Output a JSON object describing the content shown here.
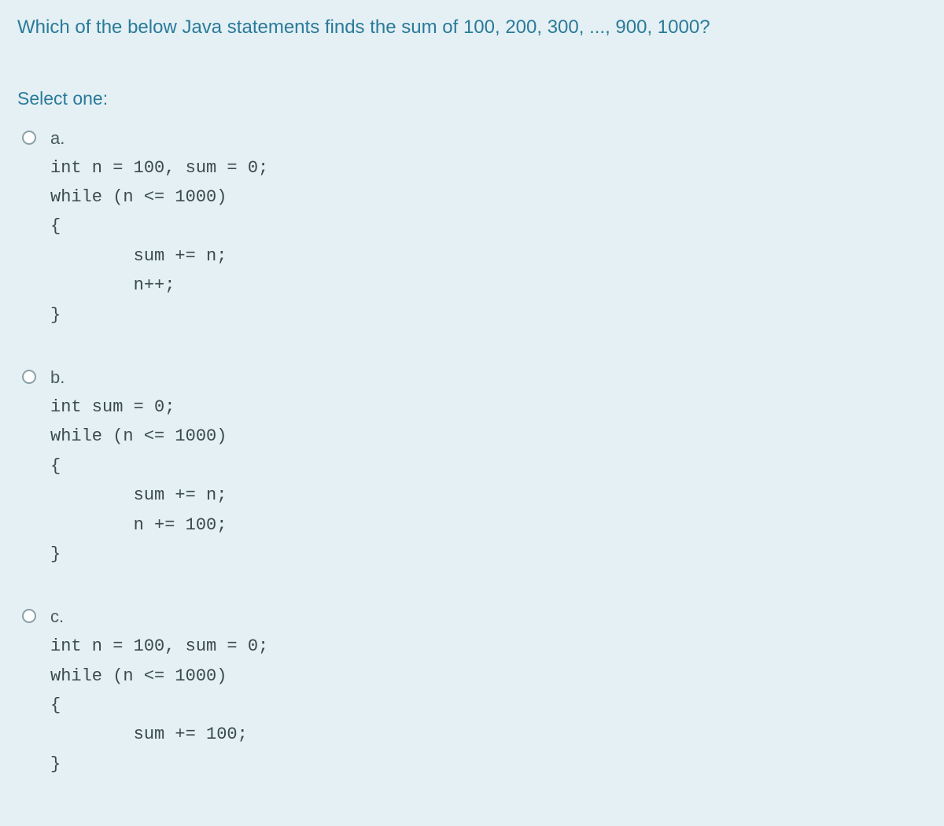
{
  "question": "Which of the below Java statements finds the sum of 100, 200, 300, ..., 900, 1000?",
  "select_prompt": "Select one:",
  "options": [
    {
      "label": "a.",
      "code": "int n = 100, sum = 0;\nwhile (n <= 1000)\n{\n        sum += n;\n        n++;\n}"
    },
    {
      "label": "b.",
      "code": "int sum = 0;\nwhile (n <= 1000)\n{\n        sum += n;\n        n += 100;\n}"
    },
    {
      "label": "c.",
      "code": "int n = 100, sum = 0;\nwhile (n <= 1000)\n{\n        sum += 100;\n}"
    }
  ]
}
